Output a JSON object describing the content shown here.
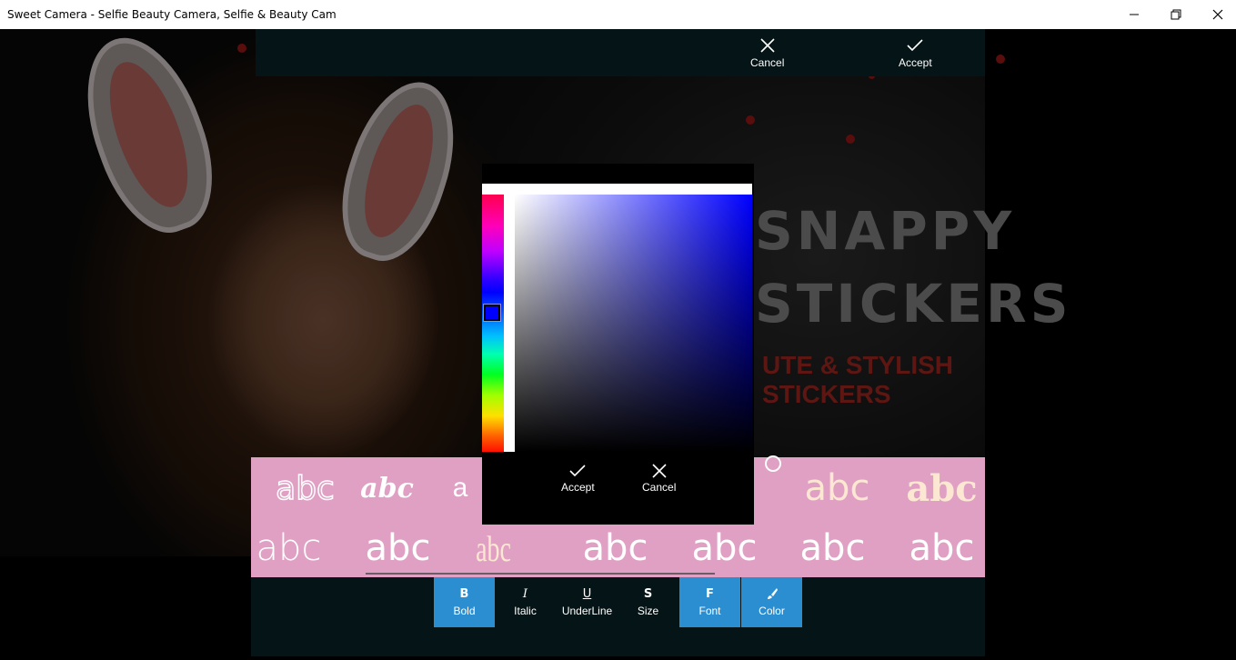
{
  "window": {
    "title": "Sweet Camera - Selfie Beauty Camera, Selfie & Beauty Cam",
    "minimize_icon": "minimize-icon",
    "maximize_icon": "restore-icon",
    "close_icon": "close-icon"
  },
  "background": {
    "headline_1": "SNAPPY",
    "headline_2": "STICKERS",
    "subline": "UTE & STYLISH STICKERS"
  },
  "topbar": {
    "cancel_label": "Cancel",
    "accept_label": "Accept"
  },
  "font_samples": {
    "row1": [
      "abc",
      "abc",
      "a",
      "",
      "",
      "abc",
      "abc"
    ],
    "row2": [
      "abc",
      "abc",
      "abc",
      "abc",
      "abc",
      "abc",
      "abc"
    ]
  },
  "toolbar": {
    "items": [
      {
        "glyph": "B",
        "label": "Bold",
        "active": true
      },
      {
        "glyph": "I",
        "label": "Italic",
        "active": false
      },
      {
        "glyph": "U",
        "label": "UnderLine",
        "active": false
      },
      {
        "glyph": "S",
        "label": "Size",
        "active": false
      },
      {
        "glyph": "F",
        "label": "Font",
        "active": true
      },
      {
        "glyph": "brush-icon",
        "label": "Color",
        "active": true
      }
    ]
  },
  "color_picker": {
    "accept_label": "Accept",
    "cancel_label": "Cancel",
    "selected_hue_color": "#0000ff"
  },
  "colors": {
    "accent": "#2b8ed1",
    "bar_bg": "#051416",
    "font_strip_bg": "#dfa0c4"
  }
}
